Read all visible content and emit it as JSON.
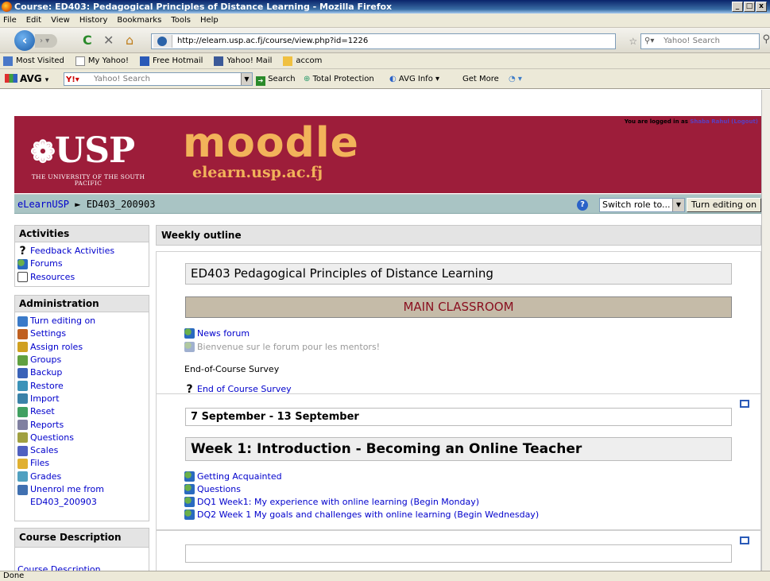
{
  "window": {
    "title": "Course: ED403: Pedagogical Principles of Distance Learning - Mozilla Firefox"
  },
  "menu": [
    "File",
    "Edit",
    "View",
    "History",
    "Bookmarks",
    "Tools",
    "Help"
  ],
  "nav": {
    "url": "http://elearn.usp.ac.fj/course/view.php?id=1226",
    "search_placeholder": "Yahoo! Search"
  },
  "bookmarks": [
    "Most Visited",
    "My Yahoo!",
    "Free Hotmail",
    "Yahoo! Mail",
    "accom"
  ],
  "avg": {
    "logo": "AVG",
    "search_placeholder": "Yahoo! Search",
    "search_btn": "Search",
    "total_protection": "Total Protection",
    "avg_info": "AVG Info",
    "get_more": "Get More"
  },
  "header": {
    "usp_logo": "USP",
    "usp_sub": "THE UNIVERSITY OF THE SOUTH PACIFIC",
    "moodle_logo": "moodle",
    "moodle_sub": "elearn.usp.ac.fj",
    "logged_in": "You are logged in as",
    "user": "Shaba Rahul",
    "logout": "(Logout)"
  },
  "breadcrumb": {
    "home": "eLearnUSP",
    "sep": "►",
    "course": "ED403_200903"
  },
  "controls": {
    "role": "Switch role to...",
    "edit": "Turn editing on"
  },
  "activities": {
    "title": "Activities",
    "items": [
      "Feedback Activities",
      "Forums",
      "Resources"
    ]
  },
  "administration": {
    "title": "Administration",
    "items": [
      "Turn editing on",
      "Settings",
      "Assign roles",
      "Groups",
      "Backup",
      "Restore",
      "Import",
      "Reset",
      "Reports",
      "Questions",
      "Scales",
      "Files",
      "Grades",
      "Unenrol me from",
      "ED403_200903"
    ]
  },
  "course_desc": {
    "title": "Course Description",
    "link": "Course Description"
  },
  "main": {
    "title": "Weekly outline",
    "section0": {
      "heading": "ED403 Pedagogical Principles of Distance Learning",
      "classroom": "MAIN CLASSROOM",
      "news": "News forum",
      "bienvenue": "Bienvenue sur le forum pour les mentors!",
      "survey_label": "End-of-Course Survey",
      "survey_link": "End of Course Survey"
    },
    "section1": {
      "dates": "7 September - 13 September",
      "heading": "Week 1: Introduction - Becoming an Online Teacher",
      "items": [
        "Getting Acquainted",
        "Questions",
        "DQ1 Week1: My experience with online learning (Begin Monday)",
        "DQ2 Week 1 My goals and challenges with online learning (Begin Wednesday)"
      ]
    }
  },
  "status": "Done"
}
